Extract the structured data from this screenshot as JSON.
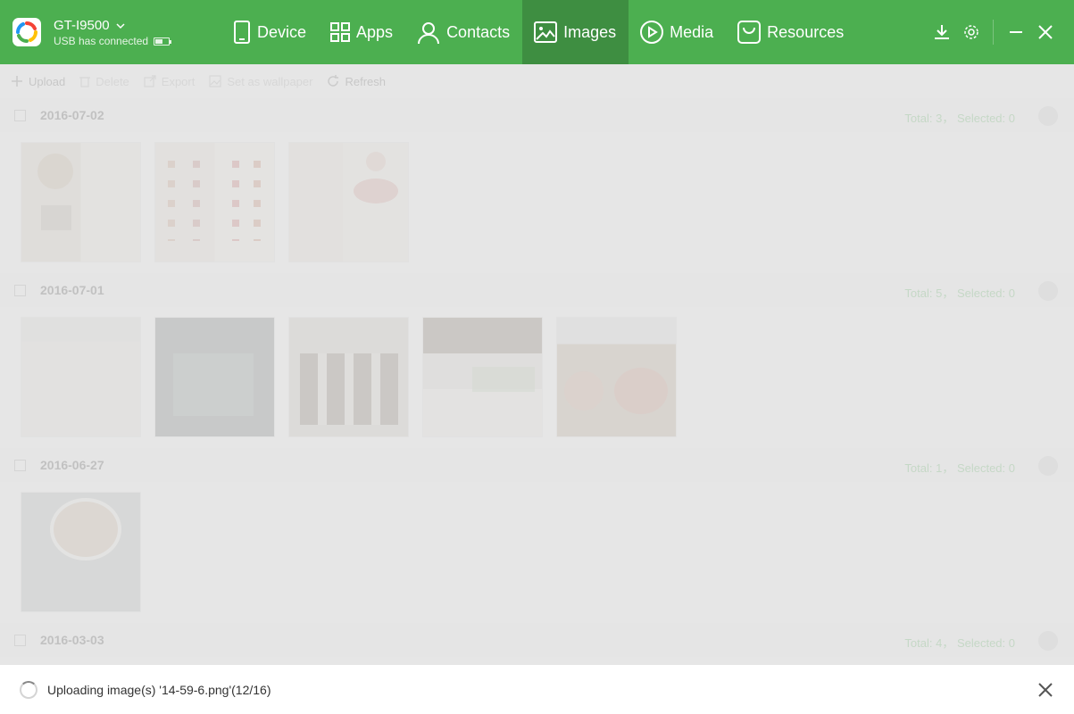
{
  "device": {
    "name": "GT-I9500",
    "status": "USB has connected",
    "battery_level": 0.6
  },
  "nav": [
    {
      "label": "Device",
      "icon": "phone-icon",
      "active": false
    },
    {
      "label": "Apps",
      "icon": "apps-grid-icon",
      "active": false
    },
    {
      "label": "Contacts",
      "icon": "person-icon",
      "active": false
    },
    {
      "label": "Images",
      "icon": "image-icon",
      "active": true
    },
    {
      "label": "Media",
      "icon": "play-circle-icon",
      "active": false
    },
    {
      "label": "Resources",
      "icon": "shopping-bag-icon",
      "active": false
    }
  ],
  "window_controls": [
    "download-icon",
    "settings-gear-icon",
    "minimize-icon",
    "close-icon"
  ],
  "toolbar": {
    "upload": "Upload",
    "delete": "Delete",
    "export": "Export",
    "set_wallpaper": "Set as wallpaper",
    "refresh": "Refresh"
  },
  "groups": [
    {
      "date": "2016-07-02",
      "meta": "Total: 3， Selected: 0",
      "thumb_count": 3
    },
    {
      "date": "2016-07-01",
      "meta": "Total: 5， Selected: 0",
      "thumb_count": 5
    },
    {
      "date": "2016-06-27",
      "meta": "Total: 1， Selected: 0",
      "thumb_count": 1
    },
    {
      "date": "2016-03-03",
      "meta": "Total: 4， Selected: 0",
      "thumb_count": 0
    }
  ],
  "status": {
    "message": "Uploading image(s) '14-59-6.png'(12/16)",
    "progress": "12/16"
  },
  "colors": {
    "header": "#4caf50",
    "active_tab": "#3e8e41",
    "accent": "#4caf50"
  }
}
